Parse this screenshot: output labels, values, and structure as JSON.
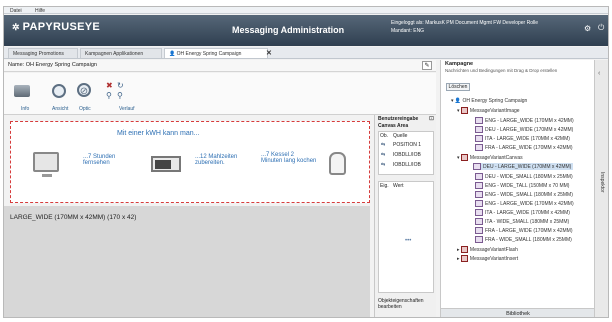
{
  "menu": [
    "Datei",
    "Hilfe"
  ],
  "brand": "PAPYRUSEYE",
  "app_title": "Messaging Administration",
  "user_line": "Eingeloggt als: MarkusK PM Document Mgmt FW Developer Rolle",
  "mandant_line": "Mandant: ENG",
  "tabs": [
    {
      "label": "Messaging Promotions"
    },
    {
      "label": "Kampagnen Applikationen"
    },
    {
      "label": "OH Energy Spring Campaign"
    }
  ],
  "name_label": "Name: OH Energy Spring Campaign",
  "toolbar": {
    "labels": [
      "Info",
      "Ansicht",
      "Optic",
      "Verlauf"
    ]
  },
  "canvas": {
    "heading": "Mit einer kWH kann man...",
    "items": [
      {
        "text": "...7 Stunden fernsehen"
      },
      {
        "text": "...12 Mahlzeiten zubereiten."
      },
      {
        "text": "...7 Kessel 2 Minuten lang kochen"
      }
    ]
  },
  "size_label": "LARGE_WIDE (170MM x 42MM) (170 x 42)",
  "mid_panel": {
    "title": "Benutzereingabe",
    "subtitle": "Canvas Area",
    "col1": "Ob.",
    "col2": "Quelle",
    "rows": [
      "POSITION 1",
      "IOBDLL/IOB",
      "IOBDLL/IOB"
    ],
    "col3": "Eig.",
    "col4": "Wert",
    "footer": "Objekteigenschaften bearbeiten"
  },
  "right_panel": {
    "title": "Kampagne",
    "subtitle": "Nachrichten und Bedingungen mit Drag & Drop erstellen",
    "delete_button": "Löschen",
    "root": "OH Energy Spring Campaign",
    "groups": [
      {
        "name": "MessageVariantImage",
        "items": [
          "ENG - LARGE_WIDE (170MM x 42MM)",
          "DEU - LARGE_WIDE (170MM x 42MM)",
          "ITA - LARGE_WIDE (170MM x 42MM)",
          "FRA - LARGE_WIDE (170MM x 42MM)"
        ]
      },
      {
        "name": "MessageVariantCanvas",
        "items": [
          "DEU - LARGE_WIDE (170MM x 42MM)",
          "DEU - WIDE_SMALL (180MM x 25MM)",
          "ENG - WIDE_TALL (150MM x 70 MM)",
          "ENG - WIDE_SMALL (180MM x 25MM)",
          "ENG - LARGE_WIDE (170MM x 42MM)",
          "ITA - LARGE_WIDE (170MM x 42MM)",
          "ITA - WIDE_SMALL (180MM x 25MM)",
          "FRA - LARGE_WIDE (170MM x 42MM)",
          "FRA - WIDE_SMALL (180MM x 25MM)"
        ]
      }
    ],
    "flash": "MessageVariantFlash",
    "insert": "MessageVariantInsert",
    "footer": "Bibliothek"
  },
  "inspector_label": "Inspektor"
}
